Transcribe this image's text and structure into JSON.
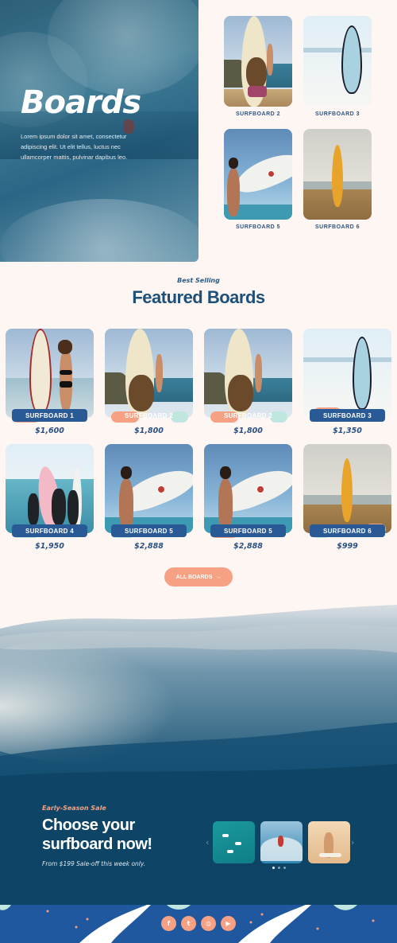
{
  "hero": {
    "title": "Boards",
    "text": "Lorem ipsum dolor sit amet, consectetur adipiscing elit. Ut elit tellus, luctus nec ullamcorper mattis, pulvinar dapibus leo."
  },
  "top_boards": [
    {
      "label": "SURFBOARD 2"
    },
    {
      "label": "SURFBOARD 3"
    },
    {
      "label": "SURFBOARD 5"
    },
    {
      "label": "SURFBOARD 6"
    }
  ],
  "featured": {
    "eyebrow": "Best Selling",
    "title": "Featured Boards",
    "products": [
      {
        "name": "SURFBOARD 1",
        "price": "$1,600"
      },
      {
        "name": "SURFBOARD 2",
        "price": "$1,800"
      },
      {
        "name": "SURFBOARD 2",
        "price": "$1,800"
      },
      {
        "name": "SURFBOARD 3",
        "price": "$1,350"
      },
      {
        "name": "SURFBOARD 4",
        "price": "$1,950"
      },
      {
        "name": "SURFBOARD 5",
        "price": "$2,888"
      },
      {
        "name": "SURFBOARD 5",
        "price": "$2,888"
      },
      {
        "name": "SURFBOARD 6",
        "price": "$999"
      }
    ],
    "button_label": "ALL BOARDS",
    "button_icon": "arrow-right-icon"
  },
  "sale": {
    "eyebrow": "Early-Season Sale",
    "title": "Choose your surfboard now!",
    "text": "From $199 Sale-off this week only.",
    "prev_icon": "chevron-left-icon",
    "next_icon": "chevron-right-icon"
  },
  "footer": {
    "social": [
      {
        "icon": "facebook-icon",
        "glyph": "f"
      },
      {
        "icon": "twitter-icon",
        "glyph": "t"
      },
      {
        "icon": "instagram-icon",
        "glyph": "◎"
      },
      {
        "icon": "youtube-icon",
        "glyph": "▶"
      }
    ]
  },
  "colors": {
    "background": "#fdf6f2",
    "primary_blue": "#2a5a96",
    "accent_peach": "#f6a183",
    "deep_navy": "#0e4566",
    "footer_blue": "#2058a0"
  }
}
